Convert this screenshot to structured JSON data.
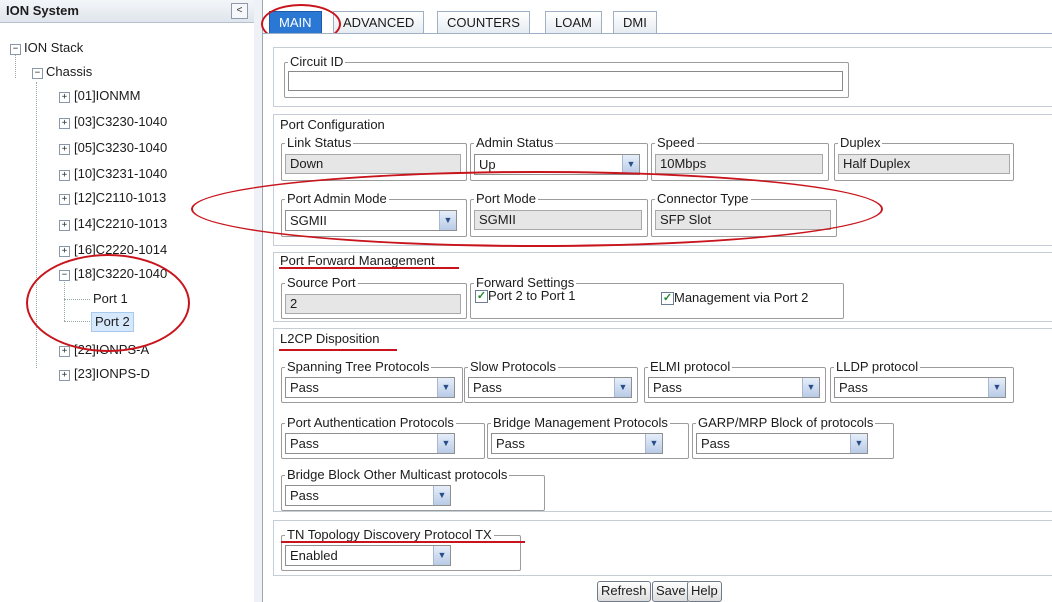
{
  "left_panel": {
    "title": "ION System",
    "collapse_icon": "chevron-left-icon",
    "tree": {
      "root": "ION Stack",
      "chassis": "Chassis",
      "modules": [
        "[01]IONMM",
        "[03]C3230-1040",
        "[05]C3230-1040",
        "[10]C3231-1040",
        "[12]C2110-1013",
        "[14]C2210-1013",
        "[16]C2220-1014",
        "[18]C3220-1040",
        "[22]IONPS-A",
        "[23]IONPS-D"
      ],
      "ports": [
        "Port 1",
        "Port 2"
      ],
      "expanded_module": "[18]C3220-1040",
      "selected": "Port 2",
      "collapse_glyph": "−",
      "expand_glyph": "+"
    }
  },
  "tabs": [
    "MAIN",
    "ADVANCED",
    "COUNTERS",
    "LOAM",
    "DMI"
  ],
  "active_tab": "MAIN",
  "circuit": {
    "legend": "Circuit ID",
    "value": ""
  },
  "port_config": {
    "title": "Port Configuration",
    "link_status": {
      "label": "Link Status",
      "value": "Down"
    },
    "admin_status": {
      "label": "Admin Status",
      "value": "Up"
    },
    "speed": {
      "label": "Speed",
      "value": "10Mbps"
    },
    "duplex": {
      "label": "Duplex",
      "value": "Half Duplex"
    },
    "port_admin_mode": {
      "label": "Port Admin Mode",
      "value": "SGMII"
    },
    "port_mode": {
      "label": "Port Mode",
      "value": "SGMII"
    },
    "connector_type": {
      "label": "Connector Type",
      "value": "SFP Slot"
    }
  },
  "port_forward": {
    "title": "Port Forward Management",
    "source_port": {
      "label": "Source Port",
      "value": "2"
    },
    "forward_settings": {
      "label": "Forward Settings",
      "port2to1": "Port 2 to Port 1",
      "mgmt_via_port2": "Management via Port 2",
      "port2to1_checked": true,
      "mgmt_checked": true
    }
  },
  "l2cp": {
    "title": "L2CP Disposition",
    "stp": {
      "label": "Spanning Tree Protocols",
      "value": "Pass"
    },
    "slow": {
      "label": "Slow Protocols",
      "value": "Pass"
    },
    "elmi": {
      "label": "ELMI protocol",
      "value": "Pass"
    },
    "lldp": {
      "label": "LLDP protocol",
      "value": "Pass"
    },
    "port_auth": {
      "label": "Port Authentication Protocols",
      "value": "Pass"
    },
    "bridge_mgmt": {
      "label": "Bridge Management Protocols",
      "value": "Pass"
    },
    "garp": {
      "label": "GARP/MRP Block of protocols",
      "value": "Pass"
    },
    "bridge_block": {
      "label": "Bridge Block Other Multicast protocols",
      "value": "Pass"
    }
  },
  "tn_topology": {
    "label": "TN Topology Discovery Protocol TX",
    "value": "Enabled"
  },
  "buttons": {
    "refresh": "Refresh",
    "save": "Save",
    "help": "Help"
  },
  "icons": {
    "dropdown": "chevron-down-icon",
    "checkbox": "checkbox-checked-icon",
    "check_glyph": "✓",
    "dropdown_glyph": "▼",
    "collapse_glyph": "<"
  },
  "colors": {
    "active_tab": "#2b78d4",
    "annotation": "#c8141c",
    "selected_node": "#d6e8fb"
  }
}
